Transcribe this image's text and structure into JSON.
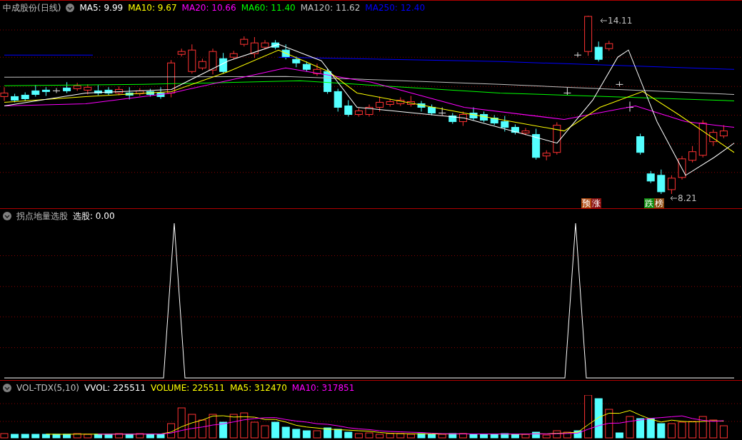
{
  "main_panel": {
    "title": "中成股份(日线)",
    "indicators": [
      {
        "label": "MA5: 9.99",
        "color": "#ffffff"
      },
      {
        "label": "MA10: 9.67",
        "color": "#ffff00"
      },
      {
        "label": "MA20: 10.66",
        "color": "#ff00ff"
      },
      {
        "label": "MA60: 11.40",
        "color": "#00ff00"
      },
      {
        "label": "MA120: 11.62",
        "color": "#c0c0c0"
      },
      {
        "label": "MA250: 12.40",
        "color": "#0000ff"
      }
    ],
    "high_label": "14.11",
    "low_label": "8.21",
    "tags": [
      {
        "text": "预",
        "color": "#b04a10"
      },
      {
        "text": "涨",
        "color": "#8a1010"
      },
      {
        "text": "跌",
        "color": "#108a10"
      },
      {
        "text": "榜",
        "color": "#8a4a10"
      }
    ]
  },
  "signal_panel": {
    "title": "拐点地量选股",
    "indicators": [
      {
        "label": "选股: 0.00",
        "color": "#ffffff"
      }
    ]
  },
  "volume_panel": {
    "title": "VOL-TDX(5,10)",
    "indicators": [
      {
        "label": "VVOL: 225511",
        "color": "#ffffff"
      },
      {
        "label": "VOLUME: 225511",
        "color": "#ffff00"
      },
      {
        "label": "MA5: 312470",
        "color": "#ffff00"
      },
      {
        "label": "MA10: 317851",
        "color": "#ff00ff"
      }
    ]
  }
}
